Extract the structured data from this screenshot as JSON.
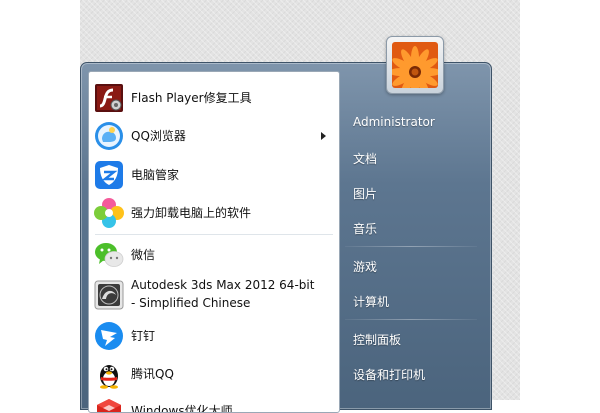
{
  "start_menu": {
    "programs": [
      {
        "label": "Flash Player修复工具",
        "icon": "flash-player-icon",
        "submenu": false
      },
      {
        "label": "QQ浏览器",
        "icon": "qq-browser-icon",
        "submenu": true
      },
      {
        "label": "电脑管家",
        "icon": "tencent-pc-manager-icon",
        "submenu": false
      },
      {
        "label": "强力卸载电脑上的软件",
        "icon": "uninstall-software-icon",
        "submenu": false
      },
      {
        "label": "微信",
        "icon": "wechat-icon",
        "submenu": false
      },
      {
        "label": "Autodesk 3ds Max 2012 64-bit",
        "label2": "- Simplified Chinese",
        "icon": "3ds-max-icon",
        "submenu": false
      },
      {
        "label": "钉钉",
        "icon": "dingtalk-icon",
        "submenu": false
      },
      {
        "label": "腾讯QQ",
        "icon": "qq-penguin-icon",
        "submenu": false
      },
      {
        "label": "Windows优化大师",
        "icon": "windows-optimizer-icon",
        "submenu": false
      }
    ],
    "right_links": [
      {
        "label": "Administrator"
      },
      {
        "label": "文档"
      },
      {
        "label": "图片"
      },
      {
        "label": "音乐"
      },
      {
        "label": "游戏"
      },
      {
        "label": "计算机"
      },
      {
        "label": "控制面板"
      },
      {
        "label": "设备和打印机"
      }
    ],
    "user_picture": "flower-avatar"
  },
  "colors": {
    "right_pane": "#5d7690",
    "left_pane": "#ffffff",
    "text_light": "#ffffff"
  }
}
